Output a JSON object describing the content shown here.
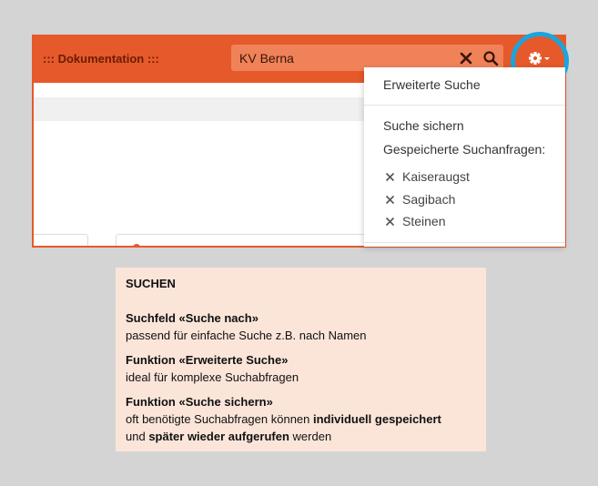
{
  "header": {
    "title": "::: Dokumentation :::",
    "search_value": "KV Berna",
    "clear_icon": "close-icon",
    "search_icon": "search-icon",
    "settings_icon": "gear-icon"
  },
  "dropdown": {
    "advanced_search": "Erweiterte Suche",
    "save_search": "Suche sichern",
    "saved_queries_label": "Gespeicherte Suchanfragen:",
    "saved_queries": [
      "Kaiseraugst",
      "Sagibach",
      "Steinen"
    ]
  },
  "content": {
    "stray_char": "!"
  },
  "info": {
    "heading": "SUCHEN",
    "s1_title": "Suchfeld «Suche nach»",
    "s1_text": "passend für einfache Suche z.B. nach Namen",
    "s2_title": "Funktion «Erweiterte Suche»",
    "s2_text": "ideal für komplexe Suchabfragen",
    "s3_title": "Funktion «Suche sichern»",
    "s3_text_1a": "oft benötigte Suchabfragen können ",
    "s3_text_1b": "individuell gespeichert",
    "s3_text_2a": "und ",
    "s3_text_2b": "später wieder aufgerufen",
    "s3_text_2c": " werden"
  },
  "colors": {
    "brand_orange": "#e6592a",
    "highlight_blue": "#1aa5dd",
    "info_bg": "#fbe5d9"
  }
}
